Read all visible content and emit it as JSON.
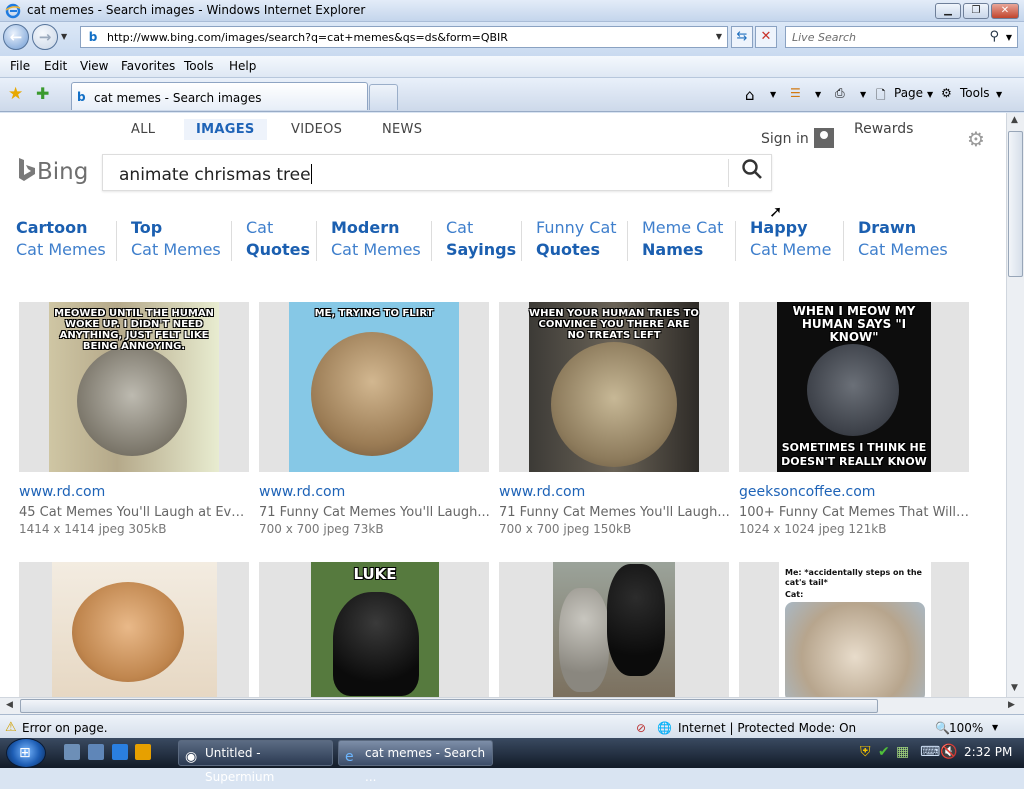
{
  "window": {
    "title": "cat memes - Search images - Windows Internet Explorer",
    "minimize": "0",
    "restore": "1",
    "close": "r"
  },
  "address_bar": {
    "url": "http://www.bing.com/images/search?q=cat+memes&qs=ds&form=QBIR",
    "live_search_placeholder": "Live Search"
  },
  "menu": [
    "File",
    "Edit",
    "View",
    "Favorites",
    "Tools",
    "Help"
  ],
  "tab": {
    "label": "cat memes - Search images"
  },
  "command_bar": {
    "page": "Page",
    "tools": "Tools"
  },
  "bing": {
    "scopes": [
      "ALL",
      "IMAGES",
      "VIDEOS",
      "NEWS"
    ],
    "active_scope": "IMAGES",
    "sign_in": "Sign in",
    "rewards": "Rewards",
    "logo": "Bing",
    "query": "animate chrismas tree",
    "pivots": [
      {
        "l1": "Cartoon",
        "l2": "Cat Memes",
        "bold": 1
      },
      {
        "l1": "Top",
        "l2": "Cat Memes",
        "bold": 1
      },
      {
        "l1": "Cat",
        "l2": "Quotes",
        "bold": 2
      },
      {
        "l1": "Modern",
        "l2": "Cat Memes",
        "bold": 1
      },
      {
        "l1": "Cat",
        "l2": "Sayings",
        "bold": 2
      },
      {
        "l1": "Funny Cat",
        "l2": "Quotes",
        "bold": 2
      },
      {
        "l1": "Meme Cat",
        "l2": "Names",
        "bold": 2
      },
      {
        "l1": "Happy",
        "l2": "Cat Meme",
        "bold": 1
      },
      {
        "l1": "Drawn",
        "l2": "Cat Memes",
        "bold": 1
      }
    ]
  },
  "results": [
    {
      "host": "www.rd.com",
      "caption": "45 Cat Memes You'll Laugh at Eve...",
      "dims": "1414 x 1414 jpeg 305kB",
      "meme_top": "MEOWED UNTIL THE HUMAN WOKE UP. I DIDN'T NEED ANYTHING, JUST FELT LIKE BEING ANNOYING.",
      "meme_bottom": ""
    },
    {
      "host": "www.rd.com",
      "caption": "71 Funny Cat Memes You'll Laugh...",
      "dims": "700 x 700 jpeg 73kB",
      "meme_top": "ME, TRYING TO FLIRT",
      "meme_bottom": ""
    },
    {
      "host": "www.rd.com",
      "caption": "71 Funny Cat Memes You'll Laugh...",
      "dims": "700 x 700 jpeg 150kB",
      "meme_top": "WHEN YOUR HUMAN TRIES TO CONVINCE YOU THERE ARE NO TREATS LEFT",
      "meme_bottom": ""
    },
    {
      "host": "geeksoncoffee.com",
      "caption": "100+ Funny Cat Memes That Will ...",
      "dims": "1024 x 1024 jpeg 121kB",
      "meme_top": "WHEN I MEOW MY HUMAN SAYS \"I KNOW\"",
      "meme_bottom": "SOMETIMES I THINK HE DOESN'T REALLY KNOW"
    },
    {
      "meme_top": "",
      "meme_bottom": ""
    },
    {
      "meme_top": "LUKE",
      "meme_bottom": ""
    },
    {
      "meme_top": "",
      "meme_bottom": ""
    },
    {
      "meme_top": "Me: *accidentally steps on the cat's tail*",
      "meme_sub": "Cat:",
      "meme_bottom": ""
    }
  ],
  "status_bar": {
    "message": "Error on page.",
    "zone": "Internet | Protected Mode: On",
    "zoom": "100%"
  },
  "taskbar": {
    "items": [
      "Untitled - Supermium",
      "cat memes - Search ..."
    ],
    "clock": "2:32 PM"
  },
  "colors": {
    "bing_blue": "#1e63b7",
    "ie_chrome": "#d9e4f2"
  }
}
